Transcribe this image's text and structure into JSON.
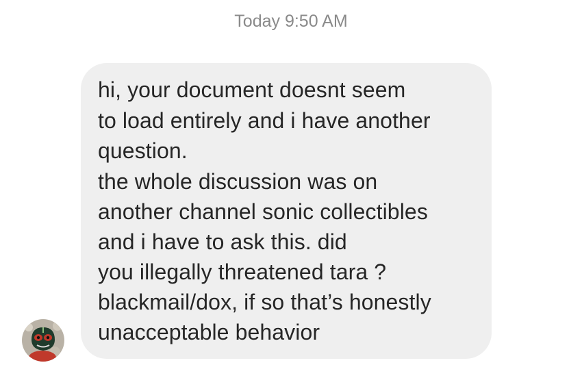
{
  "conversation": {
    "timestamp": "Today 9:50 AM",
    "message": {
      "lines": [
        "hi, your document doesnt seem",
        "to load entirely and i have another",
        "question.",
        "the whole discussion was on",
        "another channel sonic collectibles",
        "and i have to ask this. did",
        "you illegally threatened tara ?",
        "blackmail/dox, if so that’s honestly",
        "unacceptable behavior"
      ]
    },
    "sender": {
      "avatar_icon": "profile-photo-avatar"
    }
  },
  "colors": {
    "background": "#ffffff",
    "bubble": "#efefef",
    "text": "#262626",
    "timestamp": "#8a8a8a"
  }
}
